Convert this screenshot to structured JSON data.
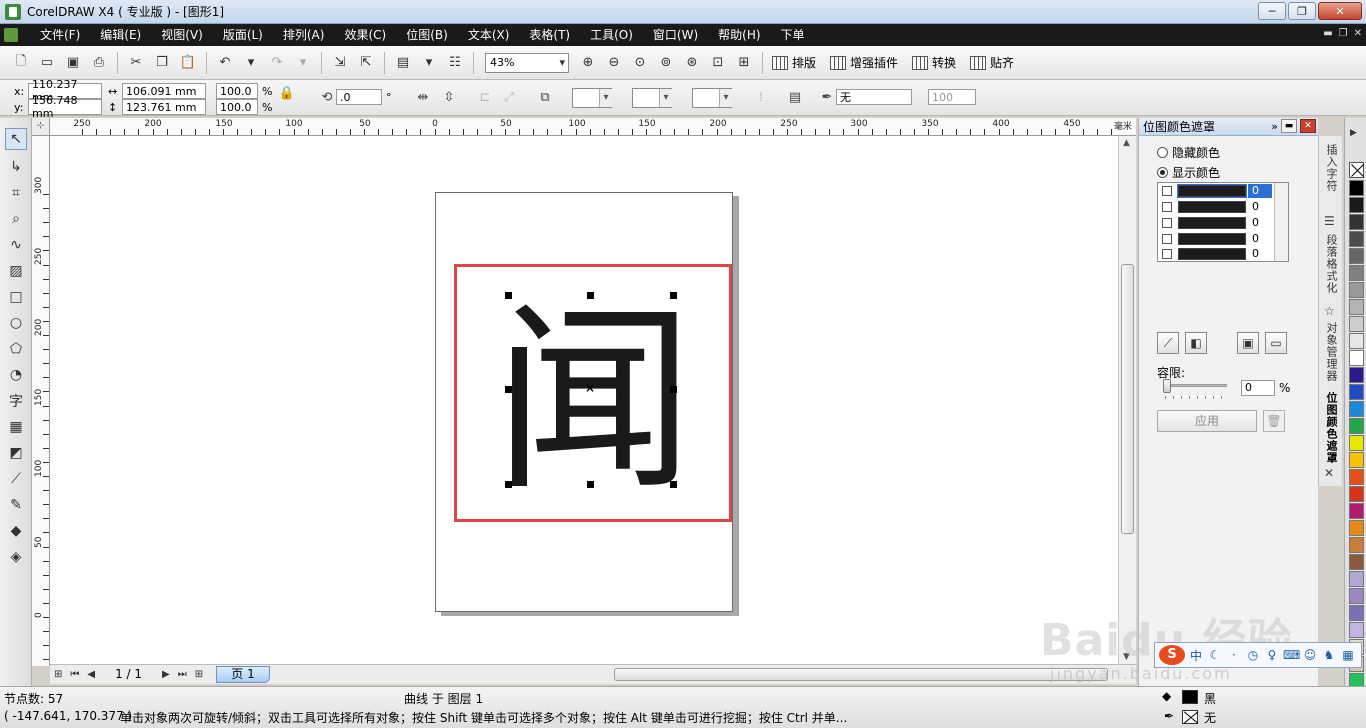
{
  "window": {
    "title": "CorelDRAW X4 ( 专业版 ) - [图形1]",
    "minimize": "─",
    "restore": "❐",
    "close": "✕"
  },
  "menu": {
    "items": [
      "文件(F)",
      "编辑(E)",
      "视图(V)",
      "版面(L)",
      "排列(A)",
      "效果(C)",
      "位图(B)",
      "文本(X)",
      "表格(T)",
      "工具(O)",
      "窗口(W)",
      "帮助(H)",
      "下单"
    ]
  },
  "toolbar": {
    "zoom": "43%",
    "plugins": [
      "排版",
      "增强插件",
      "转换",
      "贴齐"
    ]
  },
  "property_bar": {
    "x_label": "x:",
    "x": "110.237 mm",
    "y_label": "y:",
    "y": "156.748 mm",
    "width": "106.091 mm",
    "height": "123.761 mm",
    "scale_w": "100.0",
    "scale_h": "100.0",
    "percent": "%",
    "rotation": ".0",
    "degree": "°",
    "outline": "无",
    "outline_value": "100"
  },
  "rulers": {
    "unit": "毫米",
    "top_labels": [
      "250",
      "200",
      "150",
      "100",
      "50",
      "0",
      "50",
      "100",
      "150",
      "200",
      "250",
      "300",
      "350",
      "400",
      "450"
    ],
    "left_labels": [
      "300",
      "250",
      "200",
      "150",
      "100",
      "50",
      "0"
    ]
  },
  "canvas": {
    "glyph": "闻"
  },
  "page_nav": {
    "current": "1 / 1",
    "tab_label": "页 1"
  },
  "docker": {
    "title": "位图颜色遮罩",
    "hide_label": "隐藏颜色",
    "show_label": "显示颜色",
    "color_values": [
      "0",
      "0",
      "0",
      "0",
      "0"
    ],
    "tolerance_label": "容限:",
    "tolerance_value": "0",
    "tolerance_unit": "%",
    "apply_label": "应用"
  },
  "dock_tabs": [
    "插入字符",
    "段落格式化",
    "对象管理器",
    "位图颜色遮罩"
  ],
  "palette": {
    "colors": [
      "#000000",
      "#1a1a1a",
      "#333333",
      "#4d4d4d",
      "#666666",
      "#808080",
      "#999999",
      "#b3b3b3",
      "#cccccc",
      "#e6e6e6",
      "#ffffff",
      "#2c1a8c",
      "#1f4cc6",
      "#1a8ad6",
      "#22a84a",
      "#e6e600",
      "#f5c400",
      "#e64e1a",
      "#d6331a",
      "#b31a6f",
      "#e68a1a",
      "#c77c3a",
      "#8a5a3a",
      "#b3a6d6",
      "#9d86c6",
      "#7d6fb3",
      "#c6b3e6",
      "#e6d6c6",
      "#d6c6b3",
      "#22c45a"
    ]
  },
  "status": {
    "nodes": "节点数: 57",
    "object_info": "曲线 于 图层 1",
    "coords": "( -147.641, 170.377 )",
    "hint": "单击对象两次可旋转/倾斜；双击工具可选择所有对象；按住 Shift 键单击可选择多个对象；按住 Alt 键单击可进行挖掘；按住 Ctrl 并单...",
    "fill_label": "黑",
    "outline_label": "无",
    "fill_color": "#000000"
  },
  "ime": {
    "logo": "S",
    "mode": "中"
  },
  "watermark": {
    "text": "Baidu 经验",
    "sub": "jingyan.baidu.com"
  }
}
